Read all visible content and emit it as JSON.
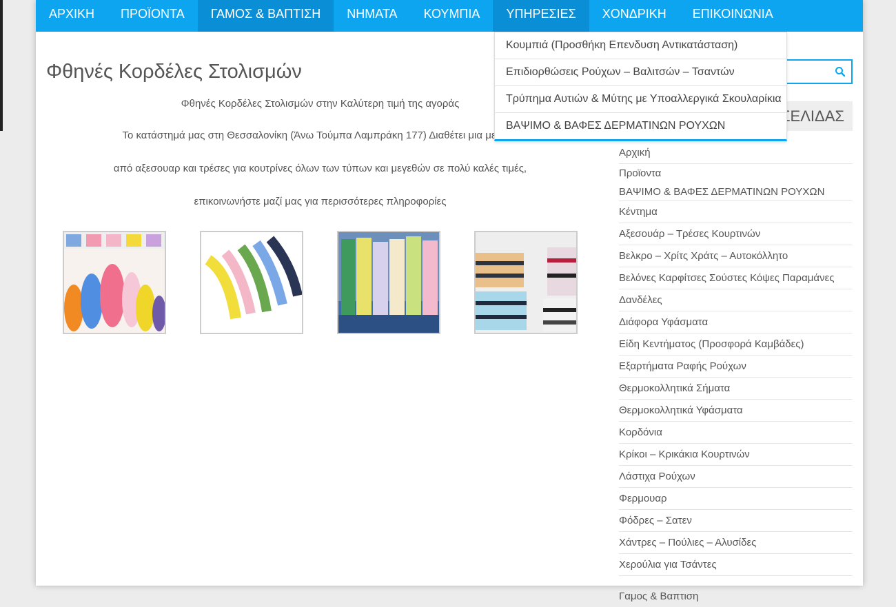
{
  "nav": {
    "items": [
      {
        "label": "ΑΡΧΙΚΗ"
      },
      {
        "label": "ΠΡΟΪΟΝΤΑ"
      },
      {
        "label": "ΓΑΜΟΣ & ΒΑΠΤΙΣΗ"
      },
      {
        "label": "ΝΗΜΑΤΑ"
      },
      {
        "label": "ΚΟΥΜΠΙΑ"
      },
      {
        "label": "ΥΠΗΡΕΣΙΕΣ"
      },
      {
        "label": "ΧΟΝΔΡΙΚΗ"
      },
      {
        "label": "ΕΠΙΚΟΙΝΩΝΙΑ"
      }
    ]
  },
  "dropdown": {
    "items": [
      {
        "label": "Κουμπιά (Προσθήκη Επενδυση Αντικατάσταση)"
      },
      {
        "label": "Επιδιορθώσεις Ρούχων – Βαλιτσών – Τσαντών"
      },
      {
        "label": "Τρύπημα Αυτιών & Μύτης με Υποαλλεργικά Σκουλαρίκια"
      },
      {
        "label": "ΒΑΨΙΜΟ & ΒΑΦΕΣ ΔΕΡΜΑΤΙΝΩΝ ΡΟΥΧΩΝ"
      }
    ]
  },
  "main": {
    "title": "Φθηνές Κορδέλες Στολισμών",
    "paragraphs": [
      "Φθηνές Κορδέλες Στολισμών στην Καλύτερη τιμή της αγοράς",
      "Το κατάστημά μας στη Θεσσαλονίκη (Άνω Τούμπα Λαμπράκη 177) Διαθέτει μια μεγάλη",
      "από αξεσουαρ και τρέσες για κουτρίνες όλων των τύπων και μεγεθών σε πολύ καλές τιμές,",
      "επικοινωνήστε μαζί μας για περισσότερες πληροφορίες"
    ]
  },
  "sidebar": {
    "widget_title": "ΚΑΤΗΓΟΡΙΕΣ ΣΕΛΙΔΑΣ",
    "categories": [
      {
        "label": "Αρχική"
      },
      {
        "label": "Προϊοντα"
      },
      {
        "label": "ΒΑΨΙΜΟ & ΒΑΦΕΣ ΔΕΡΜΑΤΙΝΩΝ ΡΟΥΧΩΝ"
      },
      {
        "label": "Κέντημα"
      },
      {
        "label": "Αξεσουάρ – Τρέσες Κουρτινών"
      },
      {
        "label": "Βελκρο – Χρίτς Χράτς – Αυτοκόλλητο"
      },
      {
        "label": "Βελόνες Καρφίτσες Σούστες Κόψες Παραμάνες"
      },
      {
        "label": "Δανδέλες"
      },
      {
        "label": "Διάφορα Υφάσματα"
      },
      {
        "label": "Είδη Κεντήματος (Προσφορά Καμβάδες)"
      },
      {
        "label": "Εξαρτήματα Ραφής Ρούχων"
      },
      {
        "label": "Θερμοκολλητικά Σήματα"
      },
      {
        "label": "Θερμοκολλητικά Υφάσματα"
      },
      {
        "label": "Κορδόνια"
      },
      {
        "label": "Κρίκοι – Κρικάκια Κουρτινών"
      },
      {
        "label": "Λάστιχα Ρούχων"
      },
      {
        "label": "Φερμουαρ"
      },
      {
        "label": "Φόδρες – Σατεν"
      },
      {
        "label": "Χάντρες – Πούλιες – Αλυσίδες"
      },
      {
        "label": "Χερούλια για Τσάντες"
      },
      {
        "label": "Γαμος & Βαπτιση"
      }
    ]
  },
  "colors": {
    "accent": "#0ea5f0",
    "nav_active": "#0a8fd6",
    "text": "#555555"
  }
}
